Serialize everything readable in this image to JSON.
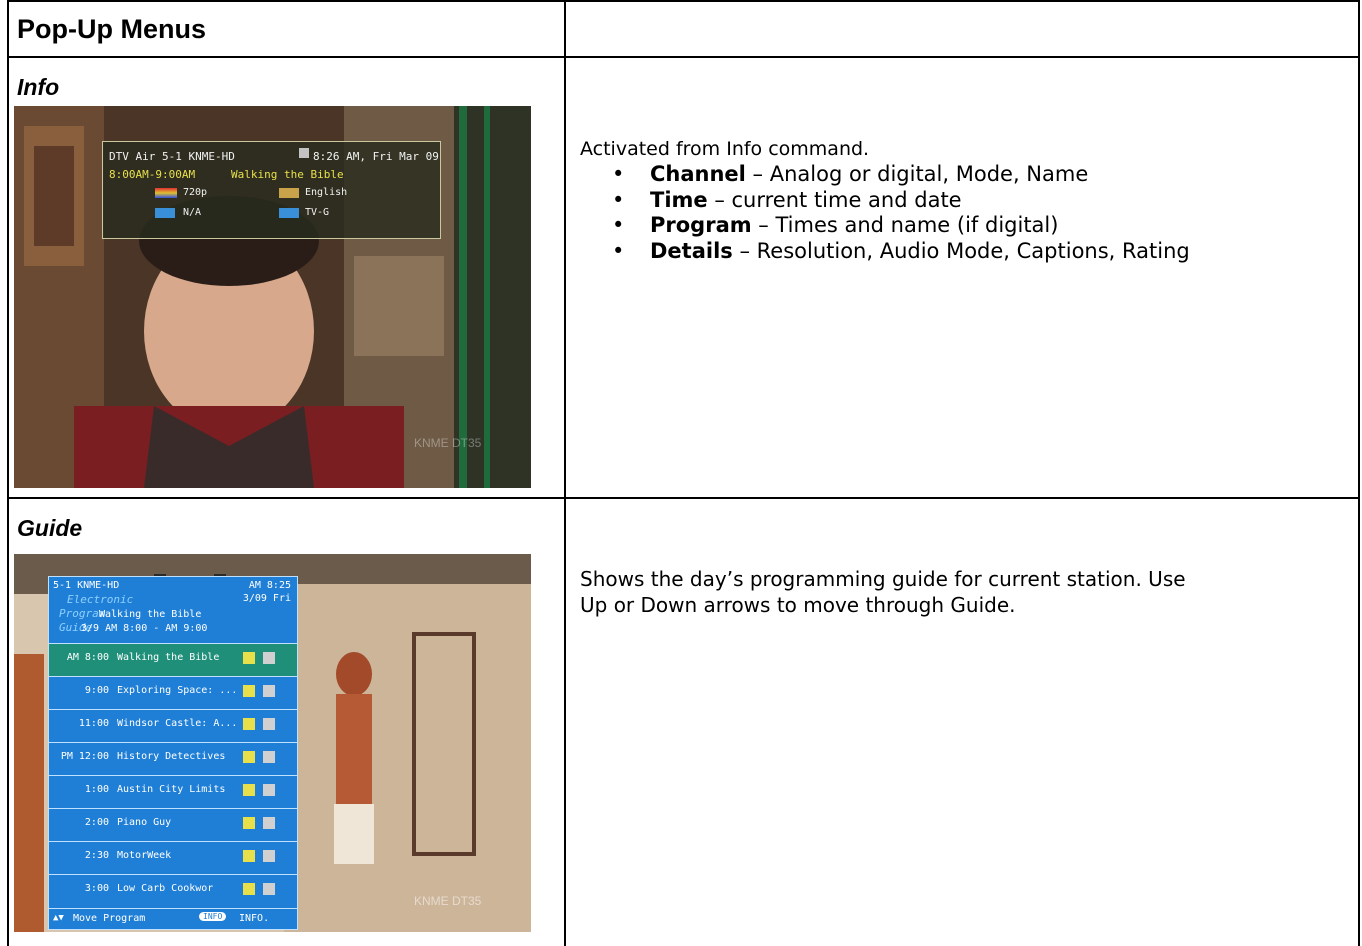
{
  "header": {
    "title": "Pop-Up Menus"
  },
  "info": {
    "title": "Info",
    "intro": "Activated from Info command.",
    "bullets": [
      {
        "term": "Channel",
        "text": " – Analog or digital, Mode, Name"
      },
      {
        "term": "Time",
        "text": " – current time and date"
      },
      {
        "term": "Program",
        "text": " – Times and name (if digital)"
      },
      {
        "term": "Details",
        "text": " – Resolution, Audio Mode, Captions, Rating"
      }
    ],
    "screen": {
      "line1_left": "DTV Air 5-1 KNME-HD",
      "line1_right": "8:26 AM, Fri Mar 09",
      "line2_left": "8:00AM-9:00AM",
      "line2_right": "Walking the Bible",
      "resolution": "720p",
      "audio": "English",
      "captions": "N/A",
      "rating": "TV-G",
      "watermark": "KNME DT35"
    }
  },
  "guide": {
    "title": "Guide",
    "intro_line1": "Shows the day’s programming guide for current station.  Use",
    "intro_line2": "Up or Down arrows to move through Guide.",
    "screen": {
      "station": "5-1 KNME-HD",
      "clock": "AM 8:25",
      "date": "3/09 Fri",
      "label1": "Electronic",
      "label2": "Program",
      "label3": "Guide",
      "current_title": "Walking the Bible",
      "current_time": "3/9 AM 8:00 - AM 9:00",
      "rows": [
        {
          "time": "AM 8:00",
          "title": "Walking the Bible"
        },
        {
          "time": "9:00",
          "title": "Exploring Space: ..."
        },
        {
          "time": "11:00",
          "title": "Windsor Castle: A..."
        },
        {
          "time": "PM 12:00",
          "title": "History Detectives"
        },
        {
          "time": "1:00",
          "title": "Austin City Limits"
        },
        {
          "time": "2:00",
          "title": "Piano Guy"
        },
        {
          "time": "2:30",
          "title": "MotorWeek"
        },
        {
          "time": "3:00",
          "title": "Low Carb Cookwor"
        }
      ],
      "footer_move": "Move Program",
      "footer_info_btn": "INFO",
      "footer_info": "INFO.",
      "watermark": "KNME DT35"
    }
  },
  "colors": {
    "guide_panel": "#1f7fd6",
    "row_highlight": "#1f8f7a",
    "osd_bg": "#2b2f1e",
    "osd_yellow": "#e8e04a"
  }
}
